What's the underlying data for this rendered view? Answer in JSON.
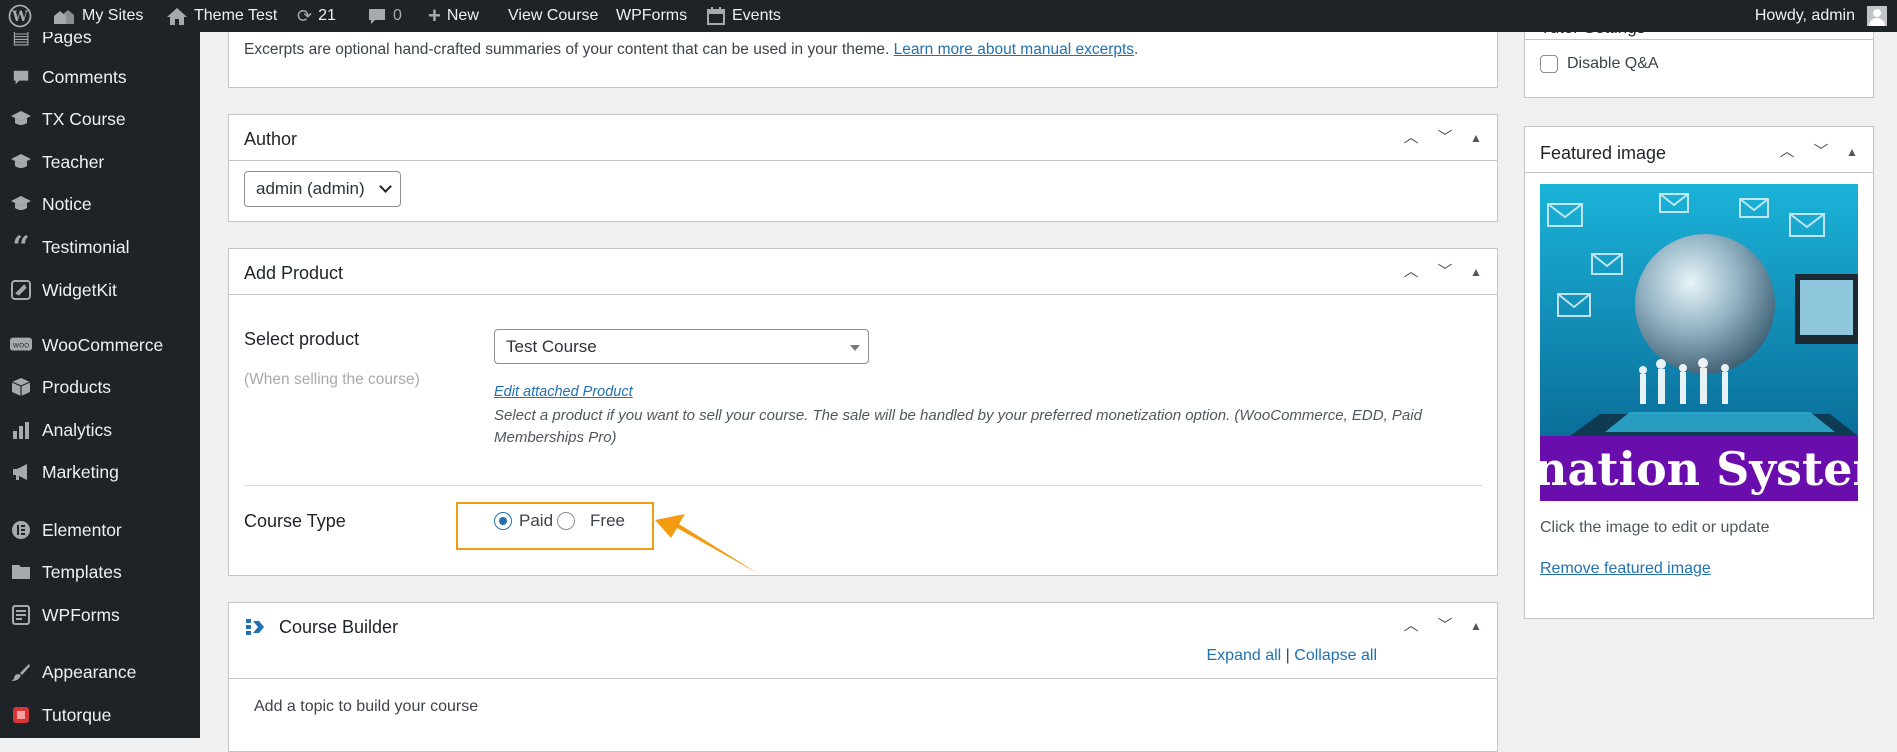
{
  "adminbar": {
    "my_sites": "My Sites",
    "site_name": "Theme Test",
    "updates_count": "21",
    "comments_count": "0",
    "new": "New",
    "view_course": "View Course",
    "wpforms": "WPForms",
    "events": "Events",
    "howdy": "Howdy, admin"
  },
  "sidebar": {
    "items": [
      {
        "label": "Pages",
        "icon": "pages-icon"
      },
      {
        "label": "Comments",
        "icon": "comments-icon"
      },
      {
        "label": "TX Course",
        "icon": "graduation-cap-icon"
      },
      {
        "label": "Teacher",
        "icon": "graduation-cap-icon"
      },
      {
        "label": "Notice",
        "icon": "graduation-cap-icon"
      },
      {
        "label": "Testimonial",
        "icon": "quote-icon"
      },
      {
        "label": "WidgetKit",
        "icon": "widgetkit-icon"
      },
      {
        "label": "WooCommerce",
        "icon": "woocommerce-icon"
      },
      {
        "label": "Products",
        "icon": "products-icon"
      },
      {
        "label": "Analytics",
        "icon": "analytics-icon"
      },
      {
        "label": "Marketing",
        "icon": "megaphone-icon"
      },
      {
        "label": "Elementor",
        "icon": "elementor-icon"
      },
      {
        "label": "Templates",
        "icon": "folder-icon"
      },
      {
        "label": "WPForms",
        "icon": "wpforms-icon"
      },
      {
        "label": "Appearance",
        "icon": "paintbrush-icon"
      },
      {
        "label": "Tutorque",
        "icon": "book-icon"
      }
    ]
  },
  "excerpt": {
    "text": "Excerpts are optional hand-crafted summaries of your content that can be used in your theme.",
    "link": "Learn more about manual excerpts",
    "period": "."
  },
  "author": {
    "title": "Author",
    "selected": "admin (admin)"
  },
  "add_product": {
    "title": "Add Product",
    "select_label": "Select product",
    "select_hint": "(When selling the course)",
    "selected_product": "Test Course",
    "edit_link": "Edit attached Product",
    "description": "Select a product if you want to sell your course. The sale will be handled by your preferred monetization option. (WooCommerce, EDD, Paid Memberships Pro)",
    "course_type_label": "Course Type",
    "options": {
      "paid": "Paid",
      "free": "Free"
    },
    "selected_type": "Paid"
  },
  "course_builder": {
    "title": "Course Builder",
    "expand_all": "Expand all",
    "separator": "|",
    "collapse_all": "Collapse all",
    "empty_text": "Add a topic to build your course"
  },
  "side": {
    "top_label": "Tutor Settings",
    "disable_qa": "Disable Q&A",
    "featured_title": "Featured image",
    "featured_image_caption": "nation System",
    "click_hint": "Click the image to edit or update",
    "remove_link": "Remove featured image"
  },
  "colors": {
    "admin_dark": "#1d2327",
    "link": "#2271b1",
    "highlight": "#f39c12"
  }
}
